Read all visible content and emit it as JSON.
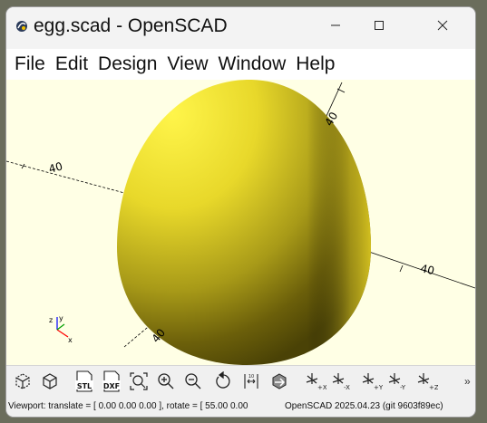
{
  "window": {
    "title": "egg.scad - OpenSCAD",
    "controls": {
      "minimize": "minimize-icon",
      "maximize": "maximize-icon",
      "close": "close-icon"
    }
  },
  "menu": [
    "File",
    "Edit",
    "Design",
    "View",
    "Window",
    "Help"
  ],
  "viewport": {
    "axis_labels": [
      "40",
      "40",
      "40",
      "40"
    ],
    "model_color": "#e6d325",
    "background": "#ffffe5"
  },
  "toolbar": [
    {
      "name": "preview-button",
      "icon": "preview-icon"
    },
    {
      "name": "render-button",
      "icon": "render-icon"
    },
    {
      "name": "export-stl-button",
      "icon": "stl-icon",
      "text": "STL"
    },
    {
      "name": "export-dxf-button",
      "icon": "dxf-icon",
      "text": "DXF"
    },
    {
      "name": "view-all-button",
      "icon": "view-all-icon"
    },
    {
      "name": "zoom-in-button",
      "icon": "zoom-in-icon"
    },
    {
      "name": "zoom-out-button",
      "icon": "zoom-out-icon"
    },
    {
      "name": "reset-view-button",
      "icon": "reset-view-icon"
    },
    {
      "name": "view-top-button",
      "icon": "top-view-icon"
    },
    {
      "name": "view-bottom-button",
      "icon": "bottom-view-icon"
    },
    {
      "name": "view-left-button",
      "icon": "left-view-icon",
      "text": "+X"
    },
    {
      "name": "view-right-button",
      "icon": "right-view-icon",
      "text": "-X"
    },
    {
      "name": "view-front-button",
      "icon": "front-view-icon",
      "text": "+Y"
    },
    {
      "name": "view-back-button",
      "icon": "back-view-icon",
      "text": "-Y"
    },
    {
      "name": "view-diagonal-button",
      "icon": "diagonal-view-icon",
      "text": "+Z"
    }
  ],
  "status": {
    "viewport_info": "Viewport: translate = [ 0.00 0.00 0.00 ], rotate = [ 55.00 0.00",
    "version": "OpenSCAD 2025.04.23 (git 9603f89ec)"
  }
}
